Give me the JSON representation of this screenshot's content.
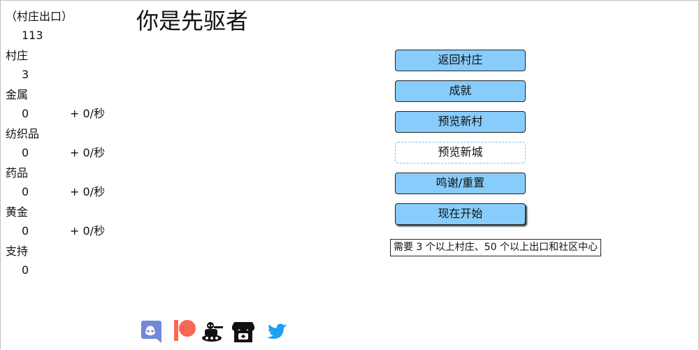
{
  "sidebar": {
    "resources": [
      {
        "name": "（村庄出口）",
        "amount": "113",
        "rate": ""
      },
      {
        "name": "村庄",
        "amount": "3",
        "rate": ""
      },
      {
        "name": "金属",
        "amount": "0",
        "rate": "+ 0/秒"
      },
      {
        "name": "纺织品",
        "amount": "0",
        "rate": "+ 0/秒"
      },
      {
        "name": "药品",
        "amount": "0",
        "rate": "+ 0/秒"
      },
      {
        "name": "黄金",
        "amount": "0",
        "rate": "+ 0/秒"
      },
      {
        "name": "支持",
        "amount": "0",
        "rate": ""
      }
    ]
  },
  "main": {
    "title": "你是先驱者",
    "buttons": {
      "return_village": "返回村庄",
      "achievements": "成就",
      "preview_village": "预览新村",
      "preview_city": "预览新城",
      "credits_reset": "鸣谢/重置",
      "start_now": "现在开始"
    },
    "requirement_note": "需要 3 个以上村庄、50 个以上出口和社区中心"
  },
  "social_icons": [
    "discord-icon",
    "patreon-icon",
    "reddit-tank-icon",
    "itch-io-icon",
    "twitter-icon"
  ],
  "colors": {
    "button_bg": "#87ccfa",
    "discord": "#7289da",
    "patreon": "#f96854",
    "twitter": "#1da1f2"
  }
}
